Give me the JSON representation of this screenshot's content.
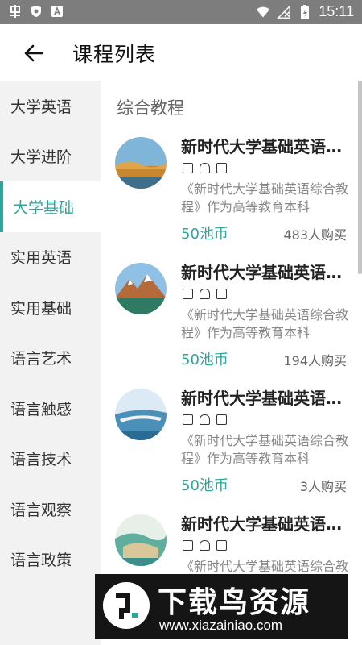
{
  "status_bar": {
    "time": "15:11",
    "left_icons": [
      "app-icon",
      "shield-icon",
      "a-icon"
    ],
    "right_icons": [
      "wifi-icon",
      "no-signal-icon",
      "battery-charging-icon"
    ]
  },
  "header": {
    "title": "课程列表"
  },
  "sidebar": {
    "items": [
      {
        "label": "大学英语"
      },
      {
        "label": "大学进阶"
      },
      {
        "label": "大学基础"
      },
      {
        "label": "实用英语"
      },
      {
        "label": "实用基础"
      },
      {
        "label": "语言艺术"
      },
      {
        "label": "语言触感"
      },
      {
        "label": "语言技术"
      },
      {
        "label": "语言观察"
      },
      {
        "label": "语言政策"
      }
    ],
    "active_index": 2,
    "accent_color": "#2aa69b"
  },
  "main": {
    "section_title": "综合教程",
    "courses": [
      {
        "title": "新时代大学基础英语综合教程",
        "desc": "《新时代大学基础英语综合教程》作为高等教育本科",
        "price": "50池币",
        "buyers": "483人购买"
      },
      {
        "title": "新时代大学基础英语综合教程",
        "desc": "《新时代大学基础英语综合教程》作为高等教育本科",
        "price": "50池币",
        "buyers": "194人购买"
      },
      {
        "title": "新时代大学基础英语综合教程",
        "desc": "《新时代大学基础英语综合教程》作为高等教育本科",
        "price": "50池币",
        "buyers": "3人购买"
      },
      {
        "title": "新时代大学基础英语综合教程",
        "desc": "《新时代大学基础英语综合教程》作为高等教育本科",
        "price": "",
        "buyers": ""
      }
    ]
  },
  "watermark": {
    "text": "下载鸟资源",
    "url": "www.xiazainiao.com"
  }
}
